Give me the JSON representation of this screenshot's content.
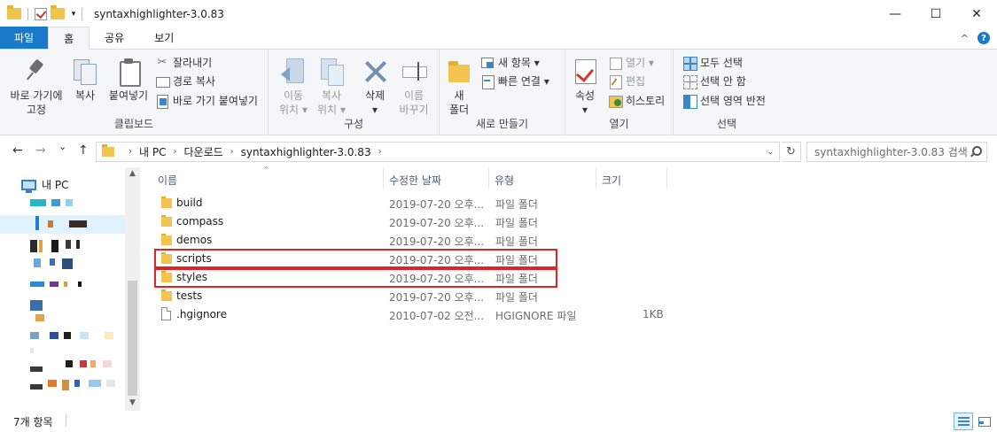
{
  "window": {
    "title": "syntaxhighlighter-3.0.83",
    "qat_dropdown": "▾",
    "minimize": "—",
    "maximize": "☐",
    "close": "✕"
  },
  "ribbon": {
    "tabs": [
      {
        "label": "파일"
      },
      {
        "label": "홈"
      },
      {
        "label": "공유"
      },
      {
        "label": "보기"
      }
    ],
    "collapse": "^",
    "help": "?",
    "clipboard": {
      "label": "클립보드",
      "pin_line1": "바로 가기에",
      "pin_line2": "고정",
      "copy": "복사",
      "paste": "붙여넣기",
      "cut": "잘라내기",
      "copy_path": "경로 복사",
      "paste_shortcut": "바로 가기 붙여넣기"
    },
    "organize": {
      "label": "구성",
      "move_line1": "이동",
      "move_line2": "위치",
      "copyto_line1": "복사",
      "copyto_line2": "위치",
      "delete": "삭제",
      "rename_line1": "이름",
      "rename_line2": "바꾸기",
      "dropdown": "▾"
    },
    "new": {
      "label": "새로 만들기",
      "folder_line1": "새",
      "folder_line2": "폴더",
      "new_item": "새 항목",
      "easy_access": "빠른 연결",
      "dropdown": "▾"
    },
    "open": {
      "label": "열기",
      "properties": "속성",
      "open": "열기",
      "edit": "편집",
      "history": "히스토리",
      "dropdown": "▾"
    },
    "select": {
      "label": "선택",
      "select_all": "모두 선택",
      "select_none": "선택 안 함",
      "invert": "선택 영역 반전"
    }
  },
  "address": {
    "back": "←",
    "forward": "→",
    "recent": "⌄",
    "up": "↑",
    "crumbs": [
      "내 PC",
      "다운로드",
      "syntaxhighlighter-3.0.83"
    ],
    "crumb_sep": "›",
    "dropdown": "⌄",
    "refresh": "↻",
    "search_placeholder": "syntaxhighlighter-3.0.83 검색"
  },
  "navpane": {
    "this_pc": "내 PC",
    "scroll_up": "▲",
    "scroll_down": "▼"
  },
  "columns": {
    "name": "이름",
    "modified": "수정한 날짜",
    "type": "유형",
    "size": "크기",
    "sort_arrow": "^"
  },
  "files": [
    {
      "name": "build",
      "modified": "2019-07-20 오후...",
      "type": "파일 폴더",
      "size": "",
      "kind": "folder"
    },
    {
      "name": "compass",
      "modified": "2019-07-20 오후...",
      "type": "파일 폴더",
      "size": "",
      "kind": "folder"
    },
    {
      "name": "demos",
      "modified": "2019-07-20 오후...",
      "type": "파일 폴더",
      "size": "",
      "kind": "folder"
    },
    {
      "name": "scripts",
      "modified": "2019-07-20 오후...",
      "type": "파일 폴더",
      "size": "",
      "kind": "folder"
    },
    {
      "name": "styles",
      "modified": "2019-07-20 오후...",
      "type": "파일 폴더",
      "size": "",
      "kind": "folder"
    },
    {
      "name": "tests",
      "modified": "2019-07-20 오후...",
      "type": "파일 폴더",
      "size": "",
      "kind": "folder"
    },
    {
      "name": ".hgignore",
      "modified": "2010-07-02 오전...",
      "type": "HGIGNORE 파일",
      "size": "1KB",
      "kind": "file"
    }
  ],
  "status": {
    "item_count": "7개 항목"
  },
  "colors": {
    "accent": "#1979ca",
    "highlight": "#e02424",
    "folder": "#f3c550"
  }
}
